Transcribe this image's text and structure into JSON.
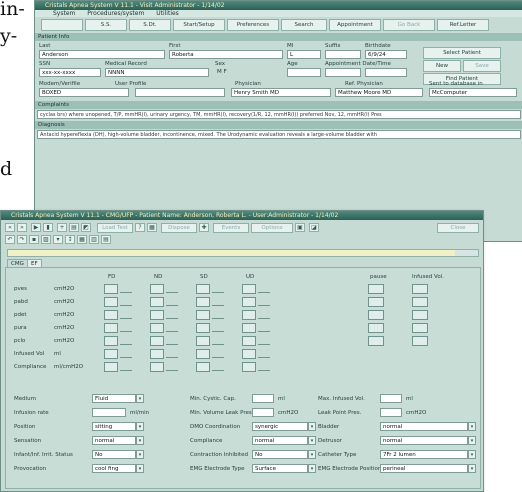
{
  "intro_lines": [
    "in-",
    "y-",
    "d"
  ],
  "win1": {
    "title": "Cristals Apnea System V 11.1 - Visit Administrator - 1/14/02",
    "menu": [
      "System",
      "Procedures/system",
      "Utilities"
    ],
    "toolbar": [
      "",
      "S.S.",
      "S.Dt.",
      "Start/Setup",
      "Preferences",
      "Search",
      "Appointment",
      "Go Back",
      "Ref.Letter"
    ],
    "patient_info_header": "Patient Info",
    "labels": {
      "last": "Last",
      "first": "First",
      "mi": "MI",
      "suffix": "Suffix",
      "birthdate": "Birthdate",
      "ssn": "SSN",
      "medical_record": "Medical Record",
      "sex": "Sex",
      "age": "Age",
      "appointment": "Appointment Date/Time",
      "modem": "Modem/Verifile",
      "user_profile": "User Profile",
      "physician": "Physician",
      "ref_physician": "Ref. Physician",
      "sent_to": "Sent to database in"
    },
    "values": {
      "last": "Anderson",
      "first": "Roberta",
      "mi": "L",
      "birthdate": "6/9/24",
      "ssn": "xxx-xx-xxxx",
      "medical_record": "NNNN",
      "sex_options": "M  F",
      "modem": "BOXED",
      "physician": "Henry Smith MD",
      "ref_physician": "Matthew Moore MD",
      "sent_to": "McComputer"
    },
    "side_buttons": [
      "Select Patient",
      "New",
      "Save",
      "Find Patient"
    ],
    "complaints_header": "Complaints",
    "complaints_text": "cyclas brs) where unopened, T/P, mmHR(I), urinary urgency, TM, mmHR(I), recovery(1/R, 12, mmHR(I)) preferred Nov, 12, mmHR(I) Pres",
    "diagnosis_header": "Diagnosis",
    "diagnosis_text": "Antacid hypereflexia (DH), high-volume bladder, incontinence, mixed. The Urodynamic evaluation reveals a large-volume bladder with"
  },
  "win2": {
    "title": "Cristals Apnea System V 11.1 - CMG/UFP - Patient Name: Anderson, Roberta L. - User:Administrator - 1/14/02",
    "toolbar_buttons": [
      "Load Test",
      "Dispose",
      "Events",
      "Options",
      "Close"
    ],
    "tabs": [
      "CMG",
      "EF"
    ],
    "column_heads": [
      "FD",
      "ND",
      "SD",
      "UD"
    ],
    "side_heads": [
      "pause",
      "Infused Vol."
    ],
    "rows": [
      {
        "label": "pves",
        "unit": "cmH2O"
      },
      {
        "label": "pabd",
        "unit": "cmH2O"
      },
      {
        "label": "pdet",
        "unit": "cmH2O"
      },
      {
        "label": "pura",
        "unit": "cmH2O"
      },
      {
        "label": "pclo",
        "unit": "cmH2O"
      },
      {
        "label": "Infused Vol",
        "unit": "ml"
      },
      {
        "label": "Compliance",
        "unit": "ml/cmH2O"
      }
    ],
    "form_rows": [
      {
        "l1": "Medium",
        "v1": "Fluid",
        "l2": "Min. Cystic. Cap.",
        "u2": "ml",
        "l3": "Max. Infused Vol.",
        "u3": "ml"
      },
      {
        "l1": "Infusion rate",
        "v1": "",
        "u1": "ml/min",
        "l2": "Min. Volume Leak Pres.",
        "u2": "cmH2O",
        "l3": "Leak Point Pres.",
        "u3": "cmH2O"
      },
      {
        "l1": "Position",
        "v1": "sitting",
        "l2": "DMO Coordination",
        "v2": "synergic",
        "l3": "Bladder",
        "v3": "normal"
      },
      {
        "l1": "Sensation",
        "v1": "normal",
        "l2": "Compliance",
        "v2": "normal",
        "l3": "Detrusor",
        "v3": "normal"
      },
      {
        "l1": "Infant/Inf. Irrit. Status",
        "v1": "No",
        "l2": "Contraction Inhibited",
        "v2": "No",
        "l3": "Catheter Type",
        "v3": "7Fr 2 lumen"
      },
      {
        "l1": "Provocation",
        "v1": "cool fing",
        "l2": "EMG Electrode Type",
        "v2": "Surface",
        "l3": "EMG Electrode Position",
        "v3": "perineal"
      }
    ],
    "progress": 0.95
  }
}
